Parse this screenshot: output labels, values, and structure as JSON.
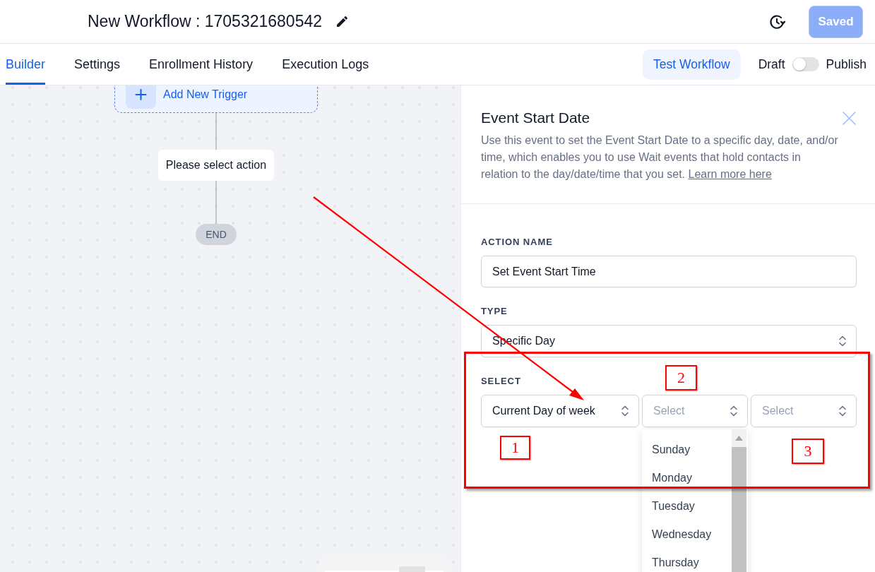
{
  "header": {
    "title": "New Workflow : 1705321680542",
    "save_button": {
      "label": "Saved",
      "disabled": true
    }
  },
  "tabs": [
    {
      "label": "Builder",
      "selected": true
    },
    {
      "label": "Settings",
      "selected": false
    },
    {
      "label": "Enrollment History",
      "selected": false
    },
    {
      "label": "Execution Logs",
      "selected": false
    }
  ],
  "toolbar": {
    "test_button": "Test Workflow",
    "publish_toggle": {
      "off_label": "Draft",
      "on_label": "Publish",
      "on": false
    }
  },
  "canvas": {
    "nodes": [
      {
        "kind": "trigger",
        "label": "Add New Trigger"
      },
      {
        "kind": "action",
        "label": "Please select action"
      },
      {
        "kind": "end",
        "label": "END"
      }
    ]
  },
  "panel": {
    "title": "Event Start Date",
    "description": "Use this event to set the Event Start Date to a specific day, date, and/or time, which enables you to use Wait events that hold contacts in relation to the day/date/time that you set.",
    "link": "Learn more here",
    "fields": [
      {
        "kind": "input",
        "label": "ACTION NAME",
        "value": "Set Event Start Time"
      },
      {
        "kind": "select",
        "label": "TYPE",
        "value": "Specific Day"
      },
      {
        "kind": "select_group",
        "label": "SELECT",
        "selects": [
          {
            "value": "Current Day of week"
          },
          {
            "placeholder": "Select",
            "options": [
              "Sunday",
              "Monday",
              "Tuesday",
              "Wednesday",
              "Thursday"
            ]
          },
          {
            "placeholder": "Select"
          }
        ]
      }
    ]
  },
  "annotations": [
    {
      "label": "1"
    },
    {
      "label": "2"
    },
    {
      "label": "3"
    }
  ]
}
